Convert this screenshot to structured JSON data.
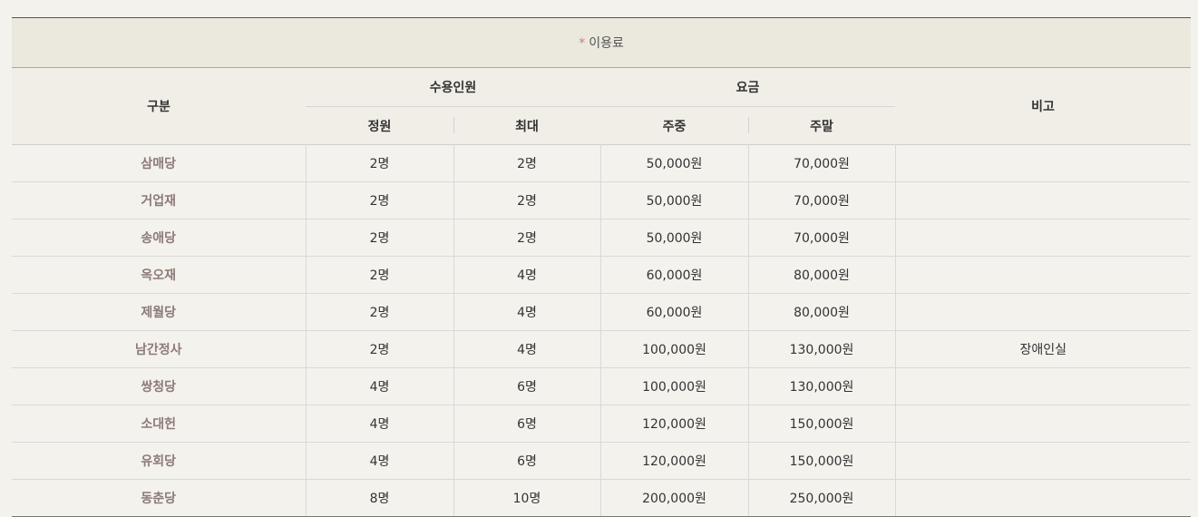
{
  "caption": {
    "star": "*",
    "text": "이용료"
  },
  "headers": {
    "category": "구분",
    "capacity": "수용인원",
    "fee": "요금",
    "note": "비고",
    "standard": "정원",
    "max": "최대",
    "weekday": "주중",
    "weekend": "주말"
  },
  "rows": [
    {
      "name": "삼매당",
      "standard": "2명",
      "max": "2명",
      "weekday": "50,000원",
      "weekend": "70,000원",
      "note": ""
    },
    {
      "name": "거업재",
      "standard": "2명",
      "max": "2명",
      "weekday": "50,000원",
      "weekend": "70,000원",
      "note": ""
    },
    {
      "name": "송애당",
      "standard": "2명",
      "max": "2명",
      "weekday": "50,000원",
      "weekend": "70,000원",
      "note": ""
    },
    {
      "name": "옥오재",
      "standard": "2명",
      "max": "4명",
      "weekday": "60,000원",
      "weekend": "80,000원",
      "note": ""
    },
    {
      "name": "제월당",
      "standard": "2명",
      "max": "4명",
      "weekday": "60,000원",
      "weekend": "80,000원",
      "note": ""
    },
    {
      "name": "남간정사",
      "standard": "2명",
      "max": "4명",
      "weekday": "100,000원",
      "weekend": "130,000원",
      "note": "장애인실"
    },
    {
      "name": "쌍청당",
      "standard": "4명",
      "max": "6명",
      "weekday": "100,000원",
      "weekend": "130,000원",
      "note": ""
    },
    {
      "name": "소대헌",
      "standard": "4명",
      "max": "6명",
      "weekday": "120,000원",
      "weekend": "150,000원",
      "note": ""
    },
    {
      "name": "유회당",
      "standard": "4명",
      "max": "6명",
      "weekday": "120,000원",
      "weekend": "150,000원",
      "note": ""
    },
    {
      "name": "동춘당",
      "standard": "8명",
      "max": "10명",
      "weekday": "200,000원",
      "weekend": "250,000원",
      "note": ""
    }
  ]
}
